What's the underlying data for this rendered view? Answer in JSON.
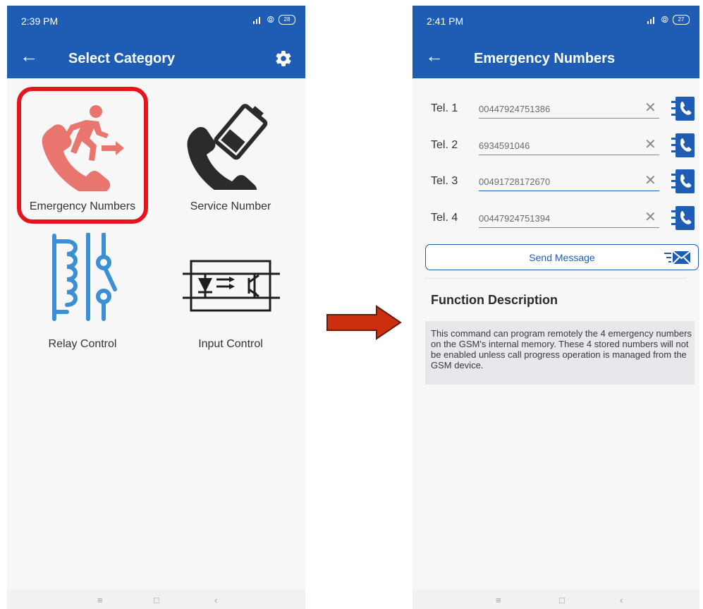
{
  "left_screen": {
    "status": {
      "time": "2:39 PM",
      "battery": "28"
    },
    "app_bar": {
      "title": "Select Category"
    },
    "tiles": [
      {
        "label": "Emergency Numbers",
        "icon": "emergency-call-icon",
        "color": "#e8766e"
      },
      {
        "label": "Service Number",
        "icon": "phone-battery-icon",
        "color": "#2b2b2b"
      },
      {
        "label": "Relay Control",
        "icon": "relay-icon",
        "color": "#3b8fd4"
      },
      {
        "label": "Input Control",
        "icon": "optocoupler-icon",
        "color": "#1e1e1e"
      }
    ],
    "highlight_color": "#e8141b"
  },
  "arrow": {
    "color": "#cc2f0f",
    "outline": "#6b1a08"
  },
  "right_screen": {
    "status": {
      "time": "2:41 PM",
      "battery": "27"
    },
    "app_bar": {
      "title": "Emergency Numbers"
    },
    "tel_fields": [
      {
        "label": "Tel. 1",
        "value": "00447924751386"
      },
      {
        "label": "Tel. 2",
        "value": "6934591046"
      },
      {
        "label": "Tel. 3",
        "value": "00491728172670"
      },
      {
        "label": "Tel. 4",
        "value": "00447924751394"
      }
    ],
    "send_button": {
      "label": "Send Message"
    },
    "function_title": "Function Description",
    "function_text": "This command can program remotely the 4 emergency numbers on the GSM's internal memory. These 4 stored numbers will not be enabled unless call progress operation is managed from the GSM device."
  },
  "colors": {
    "primary": "#1f5db4",
    "background": "#f7f7f8"
  },
  "nav": {
    "menu": "≡",
    "home": "□",
    "back": "‹"
  }
}
